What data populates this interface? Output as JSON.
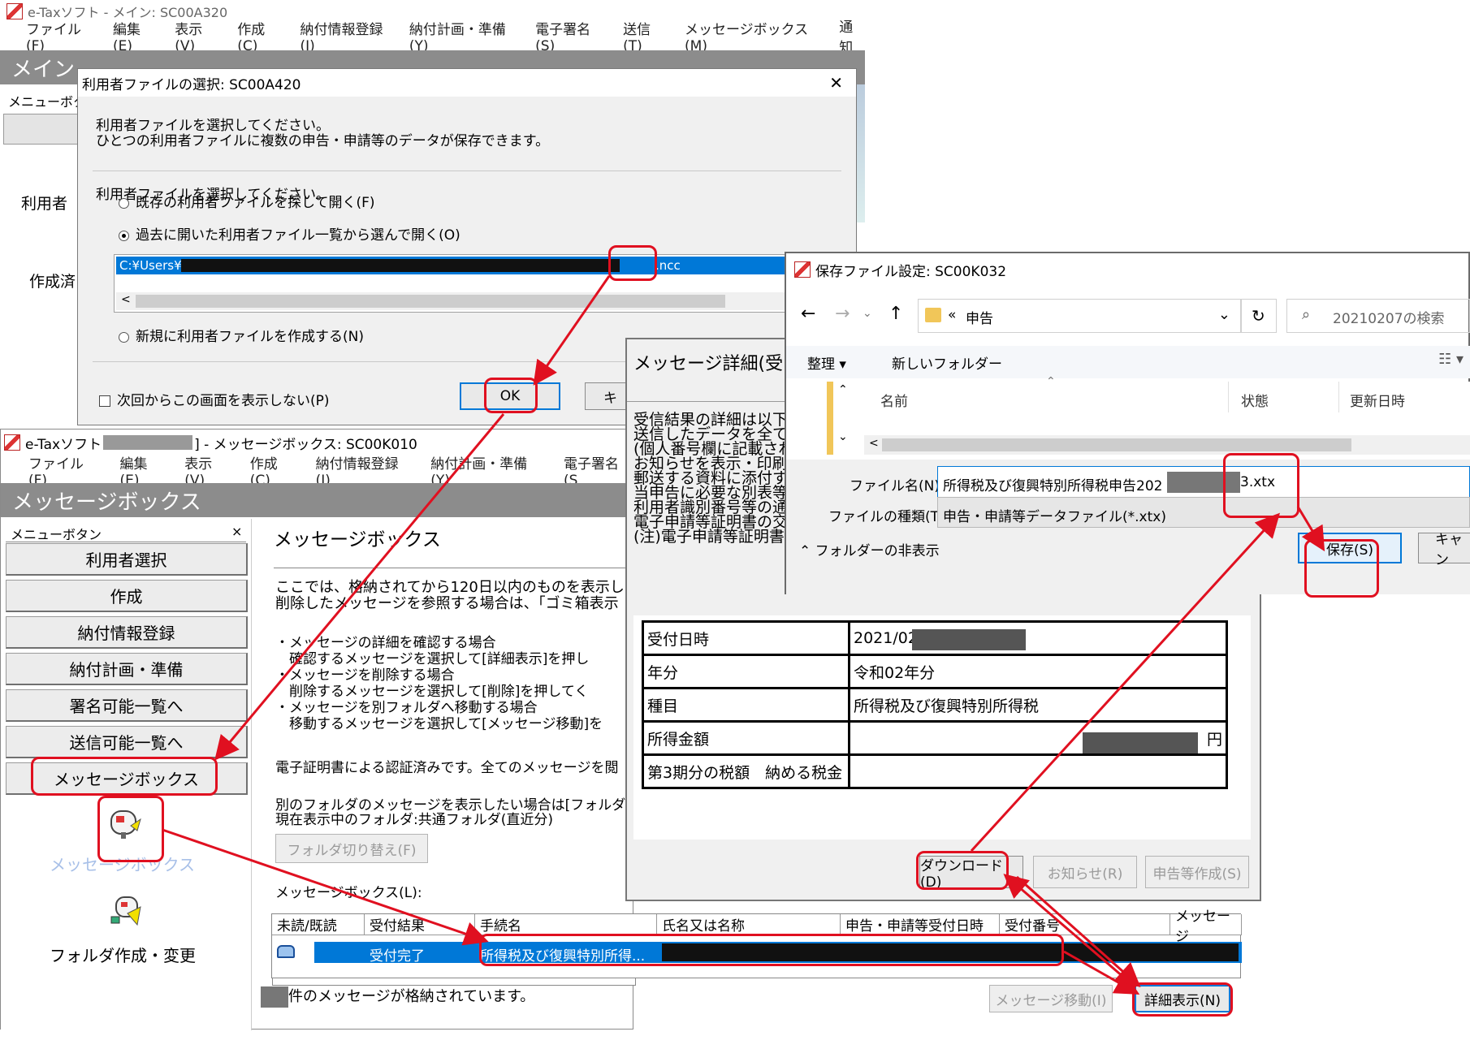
{
  "main_window": {
    "title": "e-Taxソフト - メイン: SC00A320",
    "menu": [
      "ファイル(F)",
      "編集(E)",
      "表示(V)",
      "作成(C)",
      "納付情報登録(I)",
      "納付計画・準備(Y)",
      "電子署名(S)",
      "送信(T)",
      "メッセージボックス(M)",
      "通知"
    ],
    "header": "メイン",
    "menu_button_label": "メニューボタ",
    "label_user": "利用者",
    "label_created": "作成済"
  },
  "user_file_dialog": {
    "title": "利用者ファイルの選択: SC00A420",
    "desc_line1": "利用者ファイルを選択してください。",
    "desc_line2": "ひとつの利用者ファイルに複数の申告・申請等のデータが保存できます。",
    "option_existing": "既存の利用者ファイルを探して開く(F)",
    "option_recent": "過去に開いた利用者ファイル一覧から選んで開く(O)",
    "recent_path_start": "C:¥Users¥",
    "recent_path_end": ".ncc",
    "option_new": "新規に利用者ファイルを作成する(N)",
    "dont_show": "次回からこの画面を表示しない(P)",
    "ok": "OK",
    "cancel_partial": "キ",
    "close_glyph": "✕"
  },
  "message_box_window": {
    "title_start": "e-Taxソフト",
    "title_end": "] - メッセージボックス: SC00K010",
    "menu": [
      "ファイル(F)",
      "編集(E)",
      "表示(V)",
      "作成(C)",
      "納付情報登録(I)",
      "納付計画・準備(Y)",
      "電子署名(S"
    ],
    "header": "メッセージボックス",
    "menu_button_label": "メニューボタン",
    "menu_close": "×",
    "menu_buttons": [
      "利用者選択",
      "作成",
      "納付情報登録",
      "納付計画・準備",
      "署名可能一覧へ",
      "送信可能一覧へ",
      "メッセージボックス"
    ],
    "icon_messagebox_label": "メッセージボックス",
    "icon_folder_label": "フォルダ作成・変更",
    "content_title": "メッセージボックス",
    "lines": [
      "ここでは、格納されてから120日以内のものを表示し",
      "削除したメッセージを参照する場合は、「ゴミ箱表示"
    ],
    "bullets": [
      "・メッセージの詳細を確認する場合",
      "　確認するメッセージを選択して[詳細表示]を押し",
      "・メッセージを削除する場合",
      "　削除するメッセージを選択して[削除]を押してく",
      "・メッセージを別フォルダへ移動する場合",
      "　移動するメッセージを選択して[メッセージ移動]を"
    ],
    "auth_line": "電子証明書による認証済みです。全てのメッセージを閲",
    "folder_line1": "別のフォルダのメッセージを表示したい場合は[フォルダ",
    "folder_line2": "現在表示中のフォルダ:共通フォルダ(直近分)",
    "folder_switch": "フォルダ切り替え(F)",
    "list_label": "メッセージボックス(L):",
    "columns": [
      "未読/既読",
      "受付結果",
      "手続名",
      "氏名又は名称",
      "申告・申請等受付日時",
      "受付番号",
      "メッセージ"
    ],
    "row": {
      "result": "受付完了",
      "procedure": "所得税及び復興特別所得..."
    },
    "count_text": "件のメッセージが格納されています。",
    "move_button": "メッセージ移動(I)",
    "detail_button": "詳細表示(N)"
  },
  "message_detail_window": {
    "title": "メッセージ詳細(受",
    "lines": [
      "受信結果の詳細は以下",
      "送信したデータを全て",
      "(個人番号欄に記載され",
      "お知らせを表示・印刷",
      "郵送する資料に添付す",
      "当申告に必要な別表等",
      "利用者識別番号等の通",
      "電子申請等証明書の交",
      "(注)電子申請等証明書"
    ],
    "table": [
      {
        "label": "受付日時",
        "value": "2021/02"
      },
      {
        "label": "年分",
        "value": "令和02年分"
      },
      {
        "label": "種目",
        "value": "所得税及び復興特別所得税"
      },
      {
        "label": "所得金額",
        "value": "円"
      },
      {
        "label": "第3期分の税額　納める税金",
        "value": ""
      }
    ],
    "download": "ダウンロード(D)",
    "notice": "お知らせ(R)",
    "create_return": "申告等作成(S)"
  },
  "save_dialog": {
    "title": "保存ファイル設定: SC00K032",
    "breadcrumb_prefix": "«",
    "breadcrumb": "申告",
    "search_placeholder": "20210207の検索",
    "organize": "整理 ▾",
    "new_folder": "新しいフォルダー",
    "col_name": "名前",
    "col_status": "状態",
    "col_modified": "更新日時",
    "filename_label": "ファイル名(N):",
    "filename_start": "所得税及び復興特別所得税申告202",
    "filename_end": "3.xtx",
    "filetype_label": "ファイルの種類(T):",
    "filetype": "申告・申請等データファイル(*.xtx)",
    "hide_folders": "フォルダーの非表示",
    "save": "保存(S)",
    "cancel_partial": "キャン"
  },
  "colors": {
    "annotation_red": "#e01020",
    "selection_blue": "#0078d7",
    "header_gray": "#8c8c8c"
  }
}
